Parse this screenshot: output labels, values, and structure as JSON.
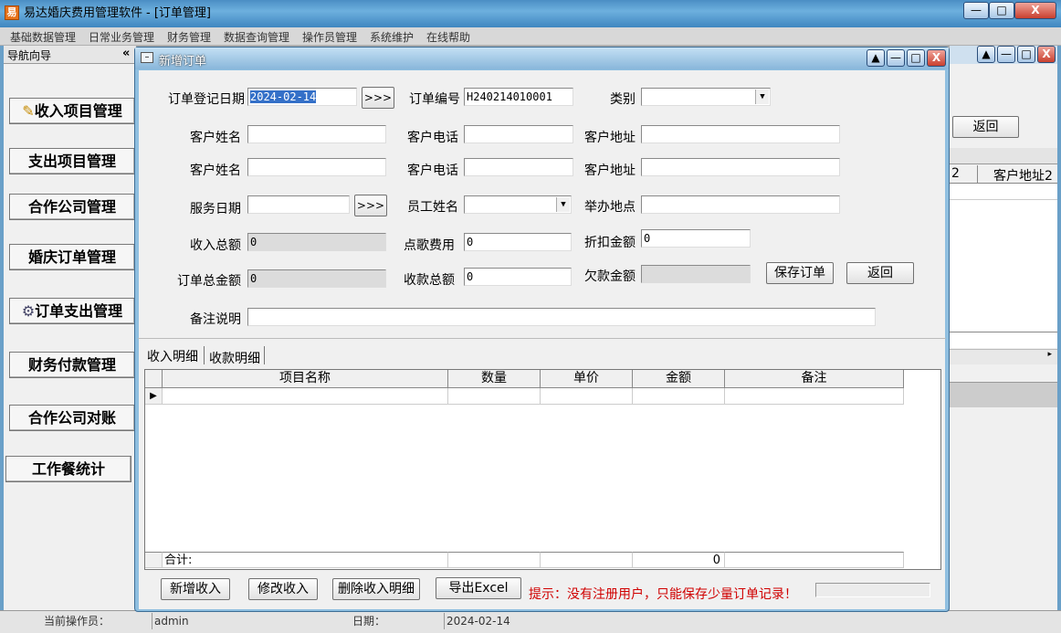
{
  "app": {
    "title": "易达婚庆费用管理软件",
    "subtitle": "- [订单管理]",
    "icon": "app-logo-icon"
  },
  "window_controls": {
    "minimize": "—",
    "maximize": "□",
    "close": "X"
  },
  "menu": [
    "基础数据管理",
    "日常业务管理",
    "财务管理",
    "数据查询管理",
    "操作员管理",
    "系统维护",
    "在线帮助"
  ],
  "nav": {
    "title": "导航向导",
    "collapse": "«",
    "items": [
      "收入项目管理",
      "支出项目管理",
      "合作公司管理",
      "婚庆订单管理",
      "订单支出管理",
      "财务付款管理",
      "合作公司对账",
      "工作餐统计"
    ]
  },
  "background_window": {
    "return_label": "返回",
    "col_partial": "2",
    "col_header": "客户地址2"
  },
  "dialog": {
    "title": "新增订单",
    "fields": {
      "order_date_label": "订单登记日期",
      "order_date": "2024-02-14",
      "date_picker": ">>>",
      "order_no_label": "订单编号",
      "order_no": "H240214010001",
      "category_label": "类别",
      "category": "",
      "customer_name_label": "客户姓名",
      "customer_phone_label": "客户电话",
      "customer_address_label": "客户地址",
      "service_date_label": "服务日期",
      "service_date": "",
      "employee_label": "员工姓名",
      "venue_label": "举办地点",
      "income_total_label": "收入总额",
      "income_total": "0",
      "song_fee_label": "点歌费用",
      "song_fee": "0",
      "discount_label": "折扣金额",
      "discount": "0",
      "order_total_label": "订单总金额",
      "order_total": "0",
      "received_total_label": "收款总额",
      "received_total": "0",
      "owed_label": "欠款金额",
      "owed": "",
      "remark_label": "备注说明",
      "remark": ""
    },
    "buttons": {
      "save": "保存订单",
      "return": "返回"
    },
    "tabs": [
      "收入明细",
      "收款明细"
    ],
    "grid": {
      "columns": [
        "项目名称",
        "数量",
        "单价",
        "金额",
        "备注"
      ],
      "total_label": "合计:",
      "total_amount": "0"
    },
    "bottom_buttons": [
      "新增收入",
      "修改收入",
      "删除收入明细",
      "导出Excel"
    ],
    "hint": "提示：没有注册用户，只能保存少量订单记录！",
    "hint_color": "#d00000"
  },
  "status": {
    "operator_label": "当前操作员：",
    "operator": "admin",
    "date_label": "日期：",
    "date": "2024-02-14"
  }
}
